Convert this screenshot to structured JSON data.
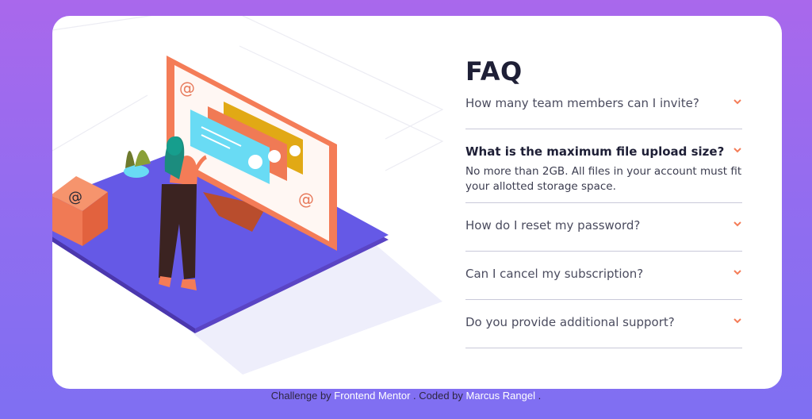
{
  "faq": {
    "title": "FAQ",
    "items": [
      {
        "question": "How many team members can I invite?",
        "open": false
      },
      {
        "question": "What is the maximum file upload size?",
        "open": true,
        "answer": "No more than 2GB. All files in your account must fit your allotted storage space."
      },
      {
        "question": "How do I reset my password?",
        "open": false
      },
      {
        "question": "Can I cancel my subscription?",
        "open": false
      },
      {
        "question": "Do you provide additional support?",
        "open": false
      }
    ]
  },
  "footer": {
    "prefix": "Challenge by",
    "link1": "Frontend Mentor",
    "middle": ". Coded by",
    "link2": "Marcus Rangel",
    "suffix": "."
  },
  "colors": {
    "background_top": "#a968ec",
    "background_bottom": "#7f6ff2",
    "card": "#ffffff",
    "accent": "#f47c57",
    "title": "#1e1f36",
    "divider": "#c9c9d9"
  },
  "icons": {
    "chevron": "chevron-down-icon",
    "illustration": "woman-online-illustration"
  }
}
